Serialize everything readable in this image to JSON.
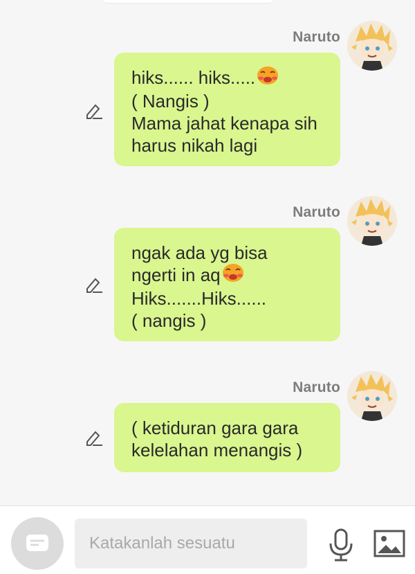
{
  "messages": [
    {
      "sender": "Naruto",
      "lines": [
        "hiks...... hiks.....",
        "( Nangis )",
        "Mama jahat kenapa sih",
        "harus nikah lagi"
      ]
    },
    {
      "sender": "Naruto",
      "lines": [
        "ngak ada yg bisa",
        "ngerti in aq",
        "Hiks.......Hiks......",
        "( nangis )"
      ]
    },
    {
      "sender": "Naruto",
      "lines": [
        "( ketiduran gara gara",
        "kelelahan menangis )"
      ]
    }
  ],
  "input": {
    "placeholder": "Katakanlah sesuatu"
  },
  "icons": {
    "emoji": "crying-face-emoji",
    "edit": "pencil-edit-icon",
    "menu": "chat-menu-icon",
    "mic": "microphone-icon",
    "image": "image-icon"
  },
  "colors": {
    "bubble": "#d9f68f",
    "background": "#f6f6f6",
    "sender": "#7c7c7c"
  }
}
